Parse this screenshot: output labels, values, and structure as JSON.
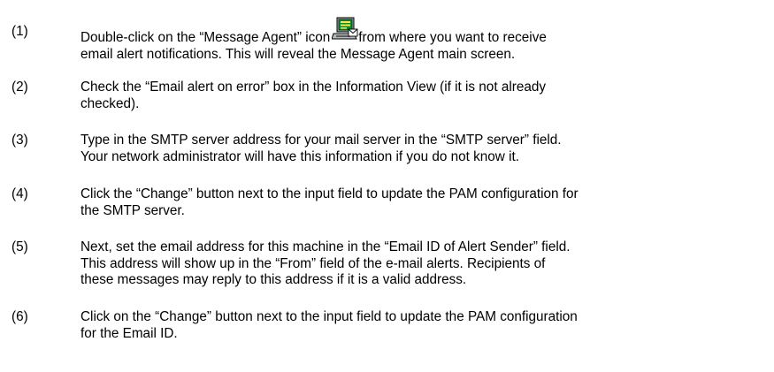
{
  "steps": [
    {
      "number": "(1)",
      "before_icon": "Double-click on the “Message Agent” icon",
      "icon": "message-agent-icon",
      "after_icon": "from where you want to receive",
      "line2": "email alert notifications. This will reveal the Message Agent main screen."
    },
    {
      "number": "(2)",
      "lines": [
        "Check the “Email alert on error” box in the Information View (if it is not already",
        "checked)."
      ]
    },
    {
      "number": "(3)",
      "lines": [
        "Type in the SMTP server address for your mail server in the “SMTP server” field.",
        "Your network administrator will have this information if you do not know it."
      ]
    },
    {
      "number": "(4)",
      "lines": [
        "Click the “Change” button next to the input field to update the PAM configuration for",
        "the SMTP server."
      ]
    },
    {
      "number": "(5)",
      "lines": [
        "Next, set the email address for this machine in the “Email ID of Alert Sender” field.",
        "This address will show up in the “From” field of the e-mail alerts. Recipients of",
        "these messages may reply to this address if it is a valid address."
      ]
    },
    {
      "number": "(6)",
      "lines": [
        "Click on the “Change” button next to the input field to update the PAM configuration",
        "for the Email ID."
      ]
    }
  ]
}
